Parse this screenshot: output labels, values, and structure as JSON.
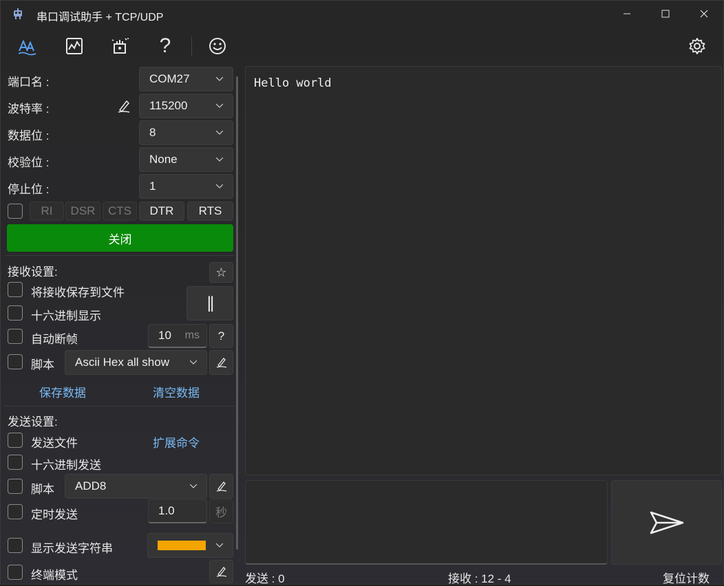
{
  "window": {
    "title": "串口调试助手 + TCP/UDP",
    "minimize_glyph": "—",
    "maximize_glyph": "☐",
    "close_glyph": "✕"
  },
  "toolbar": {
    "items": [
      "text-mode-icon",
      "chart-icon",
      "magic-wand-icon",
      "help-icon",
      "smiley-icon"
    ],
    "help_glyph": "?",
    "settings_icon": "gear-icon"
  },
  "serial": {
    "port_label": "端口名 :",
    "port_value": "COM27",
    "baud_label": "波特率 :",
    "baud_value": "115200",
    "databits_label": "数据位 :",
    "databits_value": "8",
    "parity_label": "校验位 :",
    "parity_value": "None",
    "stopbits_label": "停止位 :",
    "stopbits_value": "1",
    "signals": [
      "RI",
      "DSR",
      "CTS",
      "DTR",
      "RTS"
    ],
    "open_button": "关闭",
    "open_button_color": "#0a8a0a"
  },
  "receive": {
    "header": "接收设置:",
    "save_to_file": "将接收保存到文件",
    "hex_display": "十六进制显示",
    "auto_frame": "自动断帧",
    "frame_value": "10",
    "frame_unit": "ms",
    "frame_help": "?",
    "script_label": "脚本",
    "script_value": "Ascii Hex all show",
    "pause_glyph": "||",
    "star_glyph": "☆",
    "save_data": "保存数据",
    "clear_data": "清空数据"
  },
  "send": {
    "header": "发送设置:",
    "send_file": "发送文件",
    "ext_cmd": "扩展命令",
    "hex_send": "十六进制发送",
    "script_label": "脚本",
    "script_value": "ADD8",
    "timer_send": "定时发送",
    "timer_value": "1.0",
    "timer_unit": "秒",
    "show_send_string": "显示发送字符串",
    "send_color": "#f5a500",
    "terminal_mode": "终端模式"
  },
  "receive_area": {
    "text": "Hello world"
  },
  "status": {
    "sent": "发送 : 0",
    "received": "接收 : 12 - 4",
    "reset": "复位计数"
  },
  "colors": {
    "link": "#7ab8f0",
    "accent_blue": "#5aa0f0"
  }
}
